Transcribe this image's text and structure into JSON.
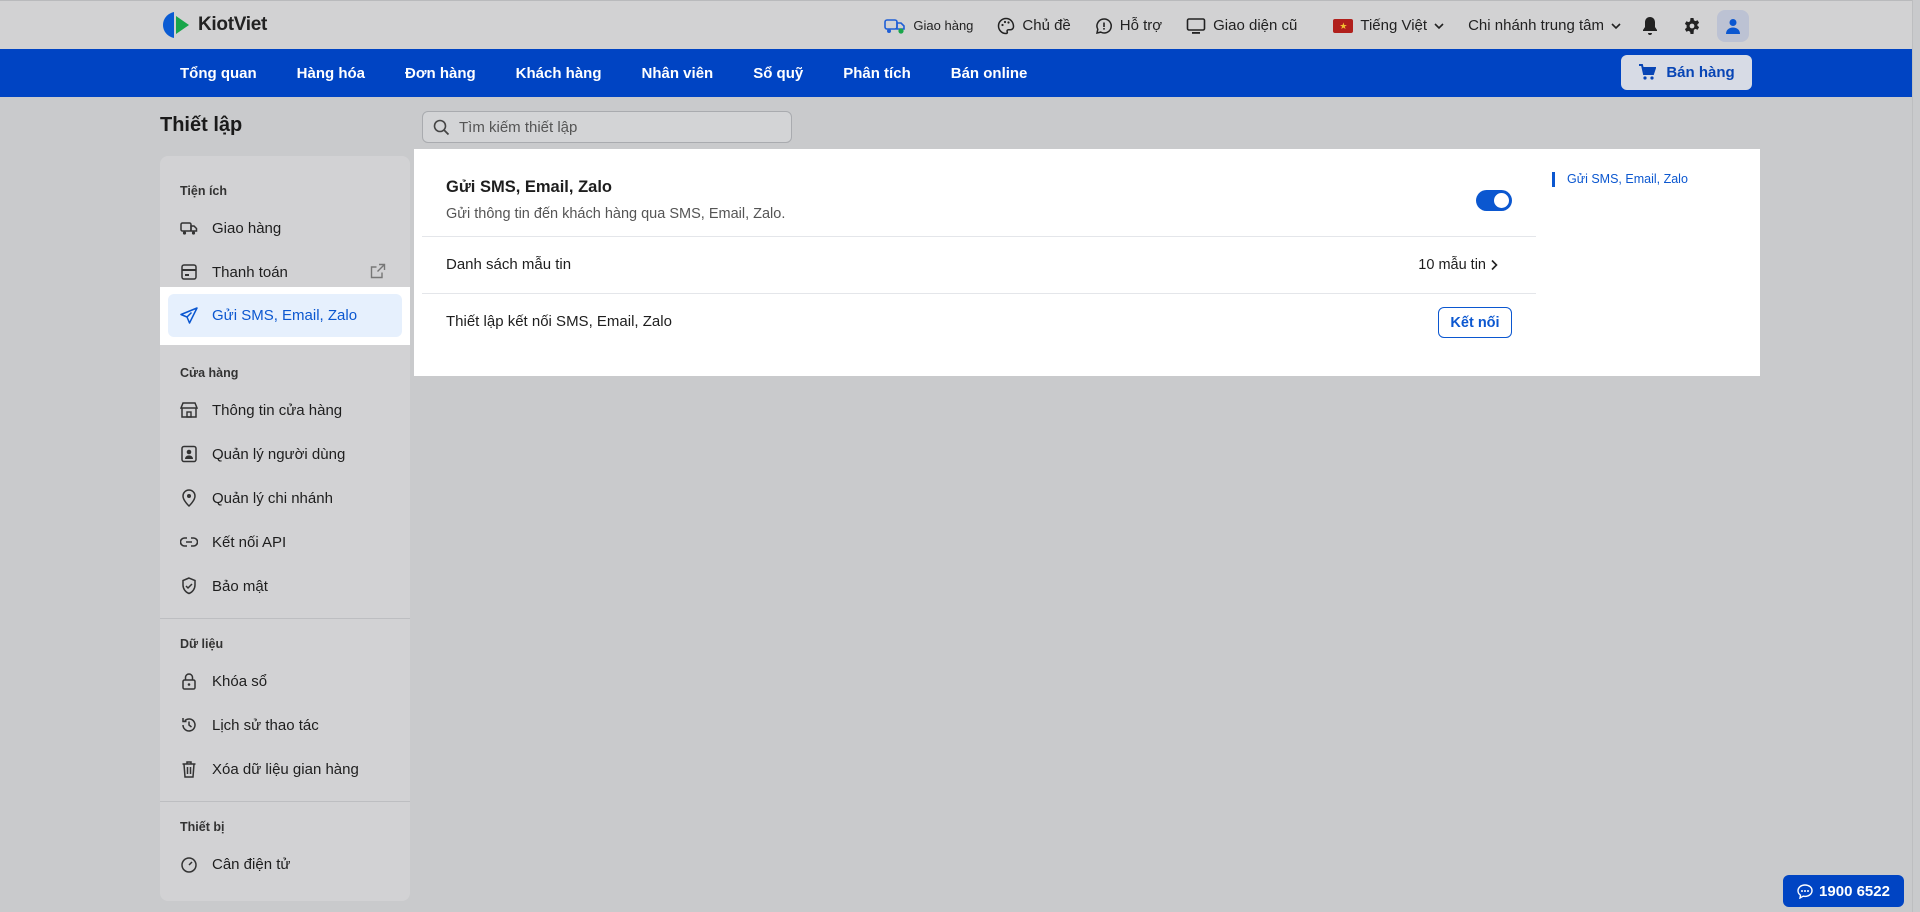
{
  "header": {
    "brand": "KiotViet",
    "links": [
      {
        "label": "Giao hàng",
        "icon": "delivery-truck-icon"
      },
      {
        "label": "Chủ đề",
        "icon": "palette-icon"
      },
      {
        "label": "Hỗ trợ",
        "icon": "chat-bubble-icon"
      },
      {
        "label": "Giao diện cũ",
        "icon": "monitor-icon"
      }
    ],
    "language": "Tiếng Việt",
    "branch": "Chi nhánh trung tâm"
  },
  "nav": {
    "items": [
      "Tổng quan",
      "Hàng hóa",
      "Đơn hàng",
      "Khách hàng",
      "Nhân viên",
      "Sổ quỹ",
      "Phân tích",
      "Bán online"
    ],
    "sell_label": "Bán hàng"
  },
  "page": {
    "title": "Thiết lập",
    "search_placeholder": "Tìm kiếm thiết lập"
  },
  "sidebar": {
    "groups": [
      {
        "title": "Tiện ích",
        "items": [
          "Giao hàng",
          "Thanh toán",
          "Gửi SMS, Email, Zalo"
        ]
      },
      {
        "title": "Cửa hàng",
        "items": [
          "Thông tin cửa hàng",
          "Quản lý người dùng",
          "Quản lý chi nhánh",
          "Kết nối API",
          "Bảo mật"
        ]
      },
      {
        "title": "Dữ liệu",
        "items": [
          "Khóa sổ",
          "Lịch sử thao tác",
          "Xóa dữ liệu gian hàng"
        ]
      },
      {
        "title": "Thiết bị",
        "items": [
          "Cân điện tử"
        ]
      }
    ],
    "active": "Gửi SMS, Email, Zalo"
  },
  "content": {
    "title": "Gửi SMS, Email, Zalo",
    "subtitle": "Gửi thông tin đến khách hàng qua SMS, Email, Zalo.",
    "toggle_on": true,
    "rows": [
      {
        "label": "Danh sách mẫu tin",
        "value": "10 mẫu tin"
      },
      {
        "label": "Thiết lập kết nối SMS, Email, Zalo",
        "button": "Kết nối"
      }
    ],
    "anchor": "Gửi SMS, Email, Zalo"
  },
  "hotline": "1900 6522",
  "colors": {
    "primary": "#0044c3",
    "accent": "#0b57d0",
    "active_bg": "#e6f0fd"
  }
}
